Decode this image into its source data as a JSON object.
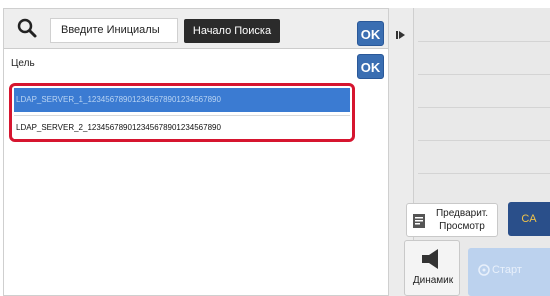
{
  "search": {
    "placeholder": "Введите Инициалы",
    "start_label": "Начало Поиска",
    "ok_label": "OK"
  },
  "target": {
    "label": "Цель",
    "ok_label": "OK"
  },
  "results": [
    {
      "text": "LDAP_SERVER_1_12345678901234567890123456789​0",
      "selected": true
    },
    {
      "text": "LDAP_SERVER_2_123456789012345678901234567890",
      "selected": false
    }
  ],
  "right": {
    "preview_label": "Предварит. Просмотр",
    "ca_label": "CA",
    "speaker_label": "Динамик",
    "start_label": "Старт"
  },
  "colors": {
    "accent": "#3a6eb2",
    "highlight_border": "#d6152f",
    "selected_row": "#3b7bd2"
  }
}
